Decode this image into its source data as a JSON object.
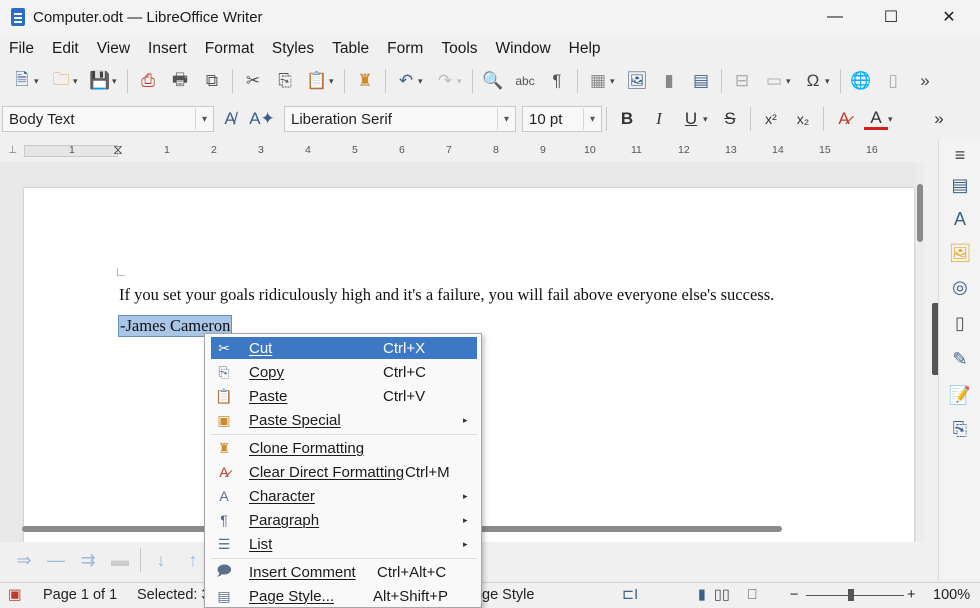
{
  "window": {
    "title": "Computer.odt — LibreOffice Writer"
  },
  "menubar": {
    "items": [
      "File",
      "Edit",
      "View",
      "Insert",
      "Format",
      "Styles",
      "Table",
      "Form",
      "Tools",
      "Window",
      "Help"
    ]
  },
  "formatting": {
    "paragraph_style": "Body Text",
    "font_name": "Liberation Serif",
    "font_size": "10 pt"
  },
  "ruler": {
    "numbers": [
      "1",
      "1",
      "2",
      "3",
      "4",
      "5",
      "6",
      "7",
      "8",
      "9",
      "10",
      "11",
      "12",
      "13",
      "14",
      "15",
      "16"
    ]
  },
  "document": {
    "line1": "If you set your goals ridiculously high and it's a failure, you will fail above everyone else's success.",
    "line2": "-James Cameron"
  },
  "context_menu": {
    "items": [
      {
        "label": "Cut",
        "shortcut": "Ctrl+X",
        "icon": "cut-icon",
        "submenu": false,
        "active": true
      },
      {
        "label": "Copy",
        "shortcut": "Ctrl+C",
        "icon": "copy-icon",
        "submenu": false,
        "active": false
      },
      {
        "label": "Paste",
        "shortcut": "Ctrl+V",
        "icon": "paste-icon",
        "submenu": false,
        "active": false
      },
      {
        "label": "Paste Special",
        "shortcut": "",
        "icon": "paste-special-icon",
        "submenu": true,
        "active": false
      },
      {
        "label": "Clone Formatting",
        "shortcut": "",
        "icon": "clone-formatting-icon",
        "submenu": false,
        "active": false
      },
      {
        "label": "Clear Direct Formatting",
        "shortcut": "Ctrl+M",
        "icon": "clear-formatting-icon",
        "submenu": false,
        "active": false
      },
      {
        "label": "Character",
        "shortcut": "",
        "icon": "character-icon",
        "submenu": true,
        "active": false
      },
      {
        "label": "Paragraph",
        "shortcut": "",
        "icon": "paragraph-icon",
        "submenu": true,
        "active": false
      },
      {
        "label": "List",
        "shortcut": "",
        "icon": "list-icon",
        "submenu": true,
        "active": false
      },
      {
        "label": "Insert Comment",
        "shortcut": "Ctrl+Alt+C",
        "icon": "comment-icon",
        "submenu": false,
        "active": false
      },
      {
        "label": "Page Style...",
        "shortcut": "Alt+Shift+P",
        "icon": "page-style-icon",
        "submenu": false,
        "active": false
      }
    ]
  },
  "statusbar": {
    "page": "Page 1 of 1",
    "selected": "Selected: 3",
    "page_style_fragment": "ge Style",
    "zoom": "100%",
    "zoom_level_percent": 100
  },
  "colors": {
    "selection": "#a9c6e8",
    "menu_highlight": "#3c78c3",
    "font_color_bar": "#d02020"
  }
}
